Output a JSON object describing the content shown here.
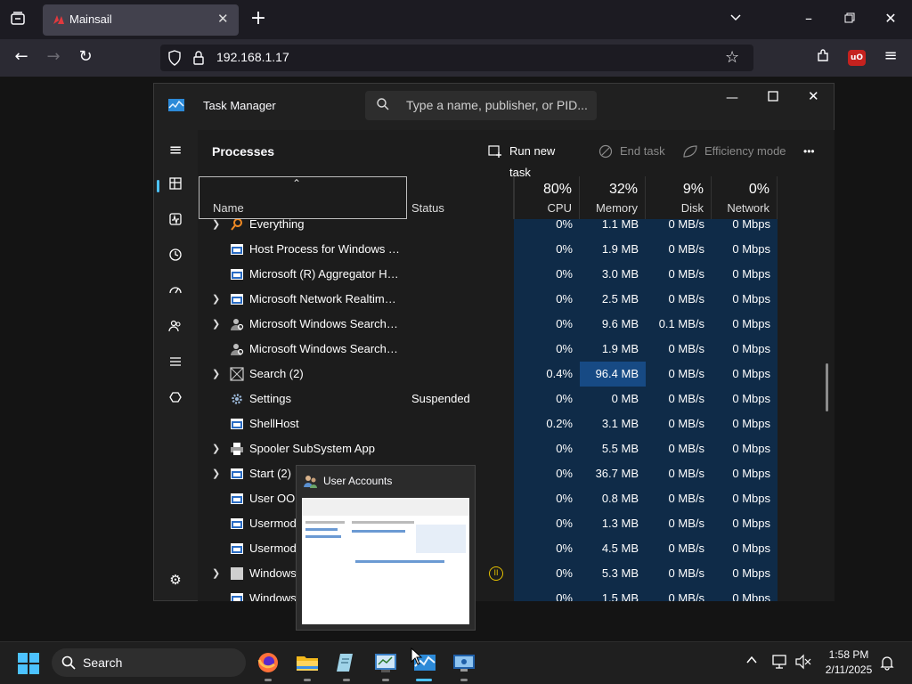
{
  "browser": {
    "tab_title": "Mainsail",
    "url": "192.168.1.17"
  },
  "taskmanager": {
    "title": "Task Manager",
    "search_placeholder": "Type a name, publisher, or PID...",
    "section_title": "Processes",
    "toolbar": {
      "run_new_task": "Run new task",
      "end_task": "End task",
      "efficiency_mode": "Efficiency mode",
      "more": "•••"
    },
    "columns": {
      "name": "Name",
      "status": "Status",
      "cpu_pct": "80%",
      "cpu": "CPU",
      "memory_pct": "32%",
      "memory": "Memory",
      "disk_pct": "9%",
      "disk": "Disk",
      "network_pct": "0%",
      "network": "Network"
    },
    "rows": [
      {
        "expand": true,
        "icon": "magnifier-icon",
        "name": "Everything",
        "status": "",
        "cpu": "0%",
        "mem": "1.1 MB",
        "disk": "0 MB/s",
        "net": "0 Mbps"
      },
      {
        "expand": false,
        "icon": "window-icon",
        "name": "Host Process for Windows Tasks",
        "status": "",
        "cpu": "0%",
        "mem": "1.9 MB",
        "disk": "0 MB/s",
        "net": "0 Mbps"
      },
      {
        "expand": false,
        "icon": "window-icon",
        "name": "Microsoft (R) Aggregator Host",
        "status": "",
        "cpu": "0%",
        "mem": "3.0 MB",
        "disk": "0 MB/s",
        "net": "0 Mbps"
      },
      {
        "expand": true,
        "icon": "window-icon",
        "name": "Microsoft Network Realtime I...",
        "status": "",
        "cpu": "0%",
        "mem": "2.5 MB",
        "disk": "0 MB/s",
        "net": "0 Mbps"
      },
      {
        "expand": true,
        "icon": "user-search-icon",
        "name": "Microsoft Windows Search In...",
        "status": "",
        "cpu": "0%",
        "mem": "9.6 MB",
        "disk": "0.1 MB/s",
        "net": "0 Mbps"
      },
      {
        "expand": false,
        "icon": "user-search-icon",
        "name": "Microsoft Windows Search Pr...",
        "status": "",
        "cpu": "0%",
        "mem": "1.9 MB",
        "disk": "0 MB/s",
        "net": "0 Mbps"
      },
      {
        "expand": true,
        "icon": "search-box-icon",
        "name": "Search (2)",
        "status": "",
        "cpu": "0.4%",
        "mem": "96.4 MB",
        "disk": "0 MB/s",
        "net": "0 Mbps",
        "mem_hi": true
      },
      {
        "expand": false,
        "icon": "gear-icon",
        "name": "Settings",
        "status": "Suspended",
        "cpu": "0%",
        "mem": "0 MB",
        "disk": "0 MB/s",
        "net": "0 Mbps"
      },
      {
        "expand": false,
        "icon": "window-icon",
        "name": "ShellHost",
        "status": "",
        "cpu": "0.2%",
        "mem": "3.1 MB",
        "disk": "0 MB/s",
        "net": "0 Mbps"
      },
      {
        "expand": true,
        "icon": "printer-icon",
        "name": "Spooler SubSystem App",
        "status": "",
        "cpu": "0%",
        "mem": "5.5 MB",
        "disk": "0 MB/s",
        "net": "0 Mbps"
      },
      {
        "expand": true,
        "icon": "window-icon",
        "name": "Start (2)",
        "status": "",
        "cpu": "0%",
        "mem": "36.7 MB",
        "disk": "0 MB/s",
        "net": "0 Mbps"
      },
      {
        "expand": false,
        "icon": "window-icon",
        "name": "User OOBE Broker",
        "status": "",
        "cpu": "0%",
        "mem": "0.8 MB",
        "disk": "0 MB/s",
        "net": "0 Mbps"
      },
      {
        "expand": false,
        "icon": "window-icon",
        "name": "Usermode Font Driver Host",
        "status": "",
        "cpu": "0%",
        "mem": "1.3 MB",
        "disk": "0 MB/s",
        "net": "0 Mbps"
      },
      {
        "expand": false,
        "icon": "window-icon",
        "name": "Usermode Font Driver Host",
        "status": "",
        "cpu": "0%",
        "mem": "4.5 MB",
        "disk": "0 MB/s",
        "net": "0 Mbps"
      },
      {
        "expand": true,
        "icon": "blank-icon",
        "name": "Windows Explorer",
        "status": "",
        "cpu": "0%",
        "mem": "5.3 MB",
        "disk": "0 MB/s",
        "net": "0 Mbps",
        "paused": true
      },
      {
        "expand": false,
        "icon": "window-icon",
        "name": "Windows Host",
        "status": "",
        "cpu": "0%",
        "mem": "1.5 MB",
        "disk": "0 MB/s",
        "net": "0 Mbps"
      }
    ]
  },
  "thumbnail": {
    "title": "User Accounts"
  },
  "taskbar": {
    "search_label": "Search",
    "time": "1:58 PM",
    "date": "2/11/2025"
  },
  "colors": {
    "accent": "#0078d4",
    "metric_bg": "#0f2b48",
    "metric_highlight": "#174a84"
  }
}
